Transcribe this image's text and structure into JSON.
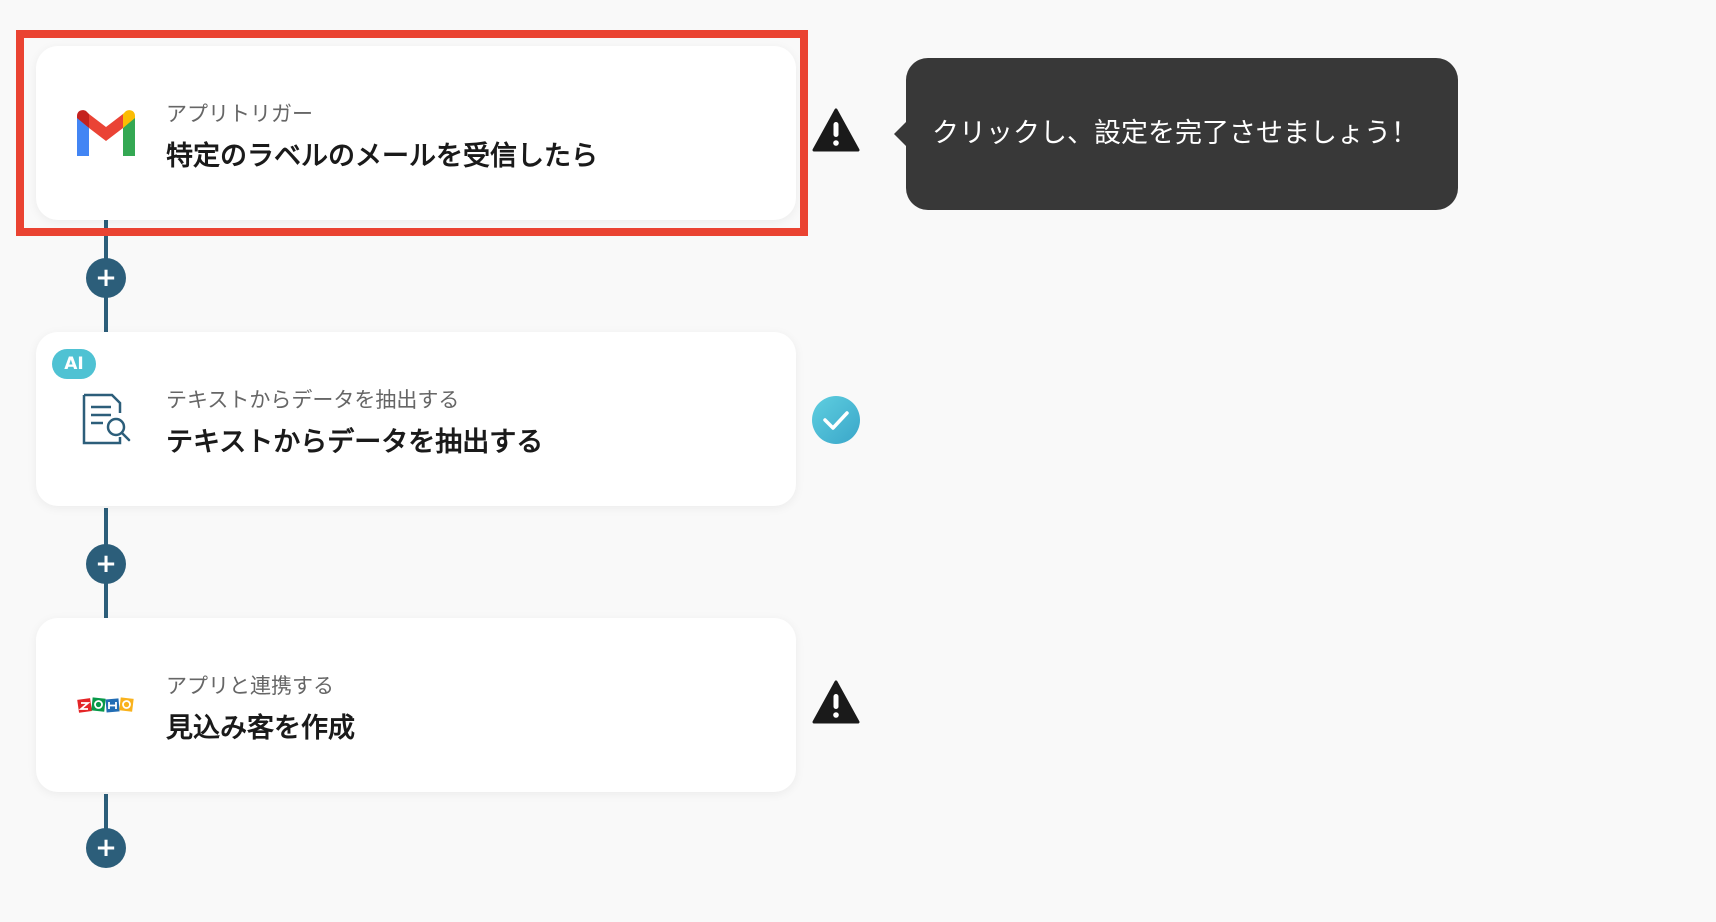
{
  "steps": [
    {
      "subtitle": "アプリトリガー",
      "title": "特定のラベルのメールを受信したら",
      "icon": "gmail-icon",
      "status": "warning-icon"
    },
    {
      "badge": "AI",
      "subtitle": "テキストからデータを抽出する",
      "title": "テキストからデータを抽出する",
      "icon": "document-search-icon",
      "status": "check-icon"
    },
    {
      "subtitle": "アプリと連携する",
      "title": "見込み客を作成",
      "icon": "zoho-logo-icon",
      "status": "warning-icon"
    }
  ],
  "tooltip": {
    "text": "クリックし、設定を完了させましょう！"
  },
  "add_step_label": "+",
  "colors": {
    "connector": "#2c5e7a",
    "highlight": "#ea4332",
    "tooltip_bg": "#383838",
    "success": "#4fc2d3",
    "warning": "#1a1a1a"
  }
}
